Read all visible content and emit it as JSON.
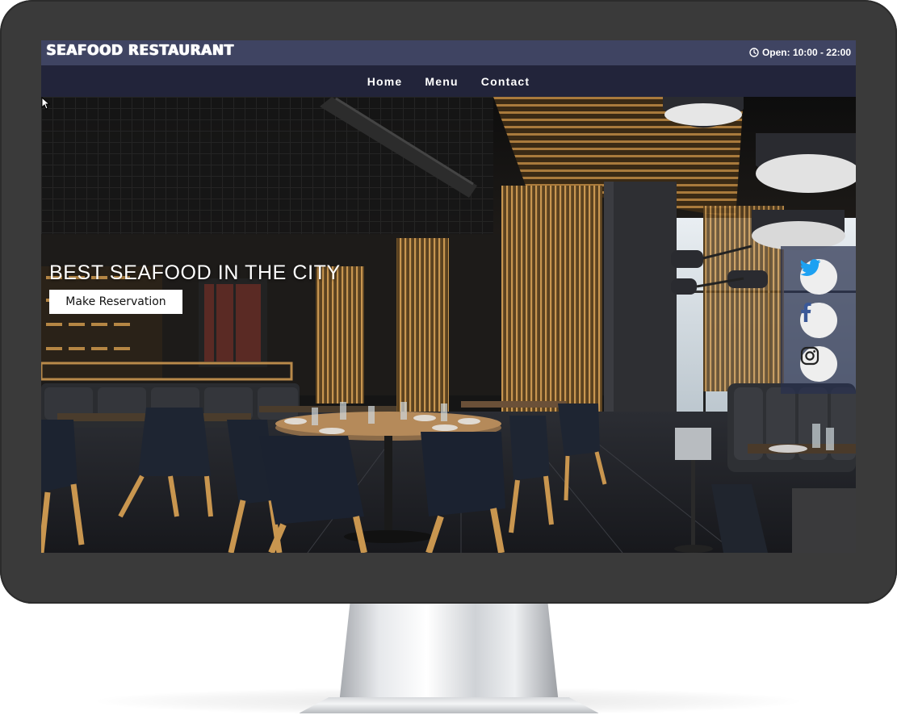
{
  "site": {
    "logo_text": "SEAFOOD RESTAURANT",
    "hours_text": "Open: 10:00 - 22:00",
    "hours_icon": "clock-icon"
  },
  "nav": {
    "items": [
      {
        "label": "Home"
      },
      {
        "label": "Menu"
      },
      {
        "label": "Contact"
      }
    ]
  },
  "hero": {
    "headline": "BEST SEAFOOD IN THE CITY",
    "cta_label": "Make Reservation"
  },
  "social": {
    "items": [
      {
        "name": "twitter",
        "icon": "twitter-icon",
        "color": "#1da1f2"
      },
      {
        "name": "facebook",
        "icon": "facebook-icon",
        "color": "#3b5998"
      },
      {
        "name": "instagram",
        "icon": "instagram-icon",
        "color": "#222222"
      }
    ]
  },
  "colors": {
    "topbar": "#3f4462",
    "navbar": "#22243a",
    "social_panel": "#28304e"
  }
}
